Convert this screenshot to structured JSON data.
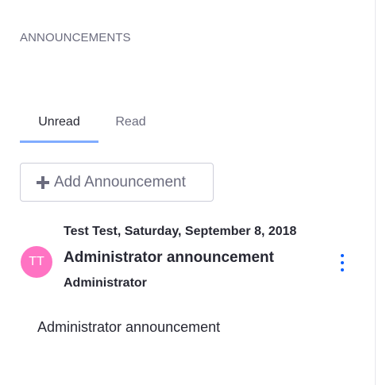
{
  "header": {
    "title": "ANNOUNCEMENTS"
  },
  "tabs": [
    {
      "label": "Unread",
      "active": true
    },
    {
      "label": "Read",
      "active": false
    }
  ],
  "toolbar": {
    "add_label": "Add Announcement"
  },
  "announcement": {
    "avatar_initials": "TT",
    "avatar_color": "#ff73c3",
    "meta": "Test Test, Saturday, September 8, 2018",
    "title": "Administrator announcement",
    "role": "Administrator",
    "body": "Administrator announcement"
  },
  "colors": {
    "accent": "#0b5fff",
    "tab_indicator": "#80acff"
  }
}
